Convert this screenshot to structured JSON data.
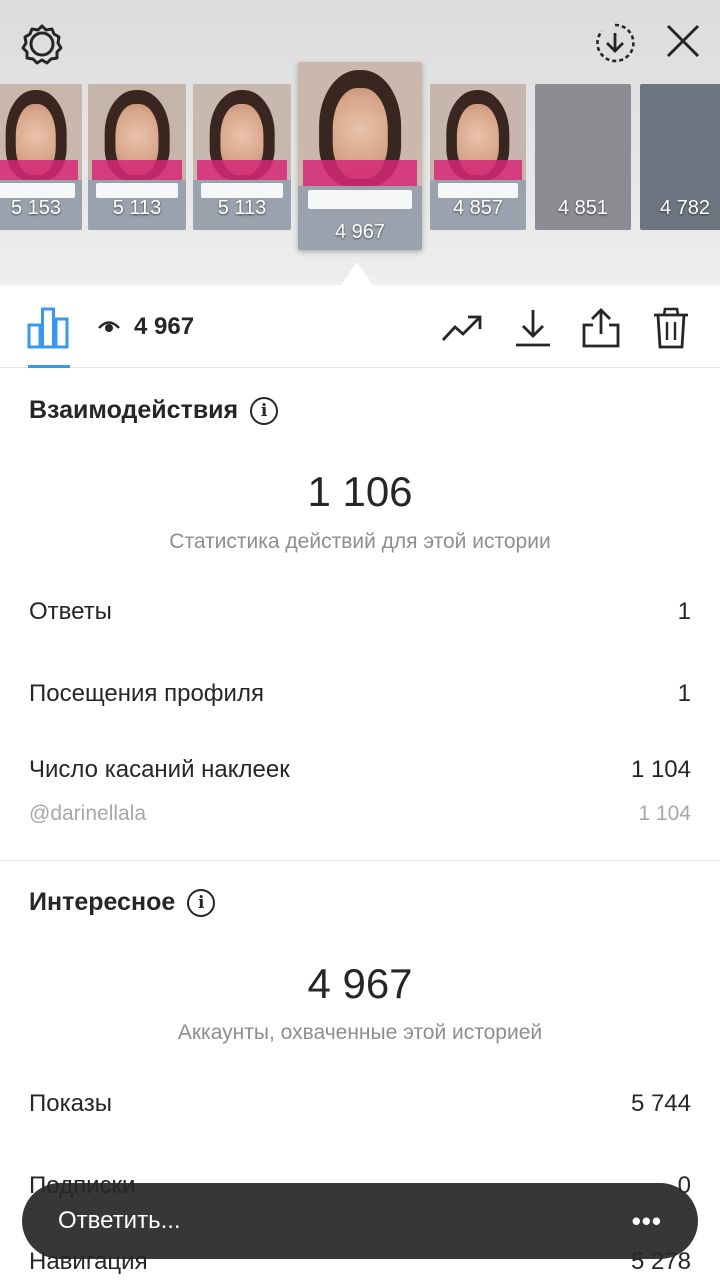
{
  "header": {
    "icons": [
      "settings-icon",
      "download-circle-icon",
      "close-icon"
    ]
  },
  "thumbnails": [
    {
      "views": "5 153",
      "tone": "#c9b7ad"
    },
    {
      "views": "5 113",
      "tone": "#c4b4aa"
    },
    {
      "views": "5 113",
      "tone": "#c8b9b0"
    },
    {
      "views": "4 967",
      "tone": "#cbb8ad",
      "current": true
    },
    {
      "views": "4 857",
      "tone": "#c6b6ad"
    },
    {
      "views": "4 851",
      "tone": "#8c8d93"
    },
    {
      "views": "4 782",
      "tone": "#6d7680"
    }
  ],
  "toolbar": {
    "view_count": "4 967",
    "icons": [
      "bar-chart-icon",
      "eye-icon",
      "trending-icon",
      "download-icon",
      "share-icon",
      "trash-icon"
    ]
  },
  "interactions": {
    "title": "Взаимодействия",
    "total": "1 106",
    "subtitle": "Статистика действий для этой истории",
    "rows": [
      {
        "label": "Ответы",
        "value": "1"
      },
      {
        "label": "Посещения профиля",
        "value": "1"
      },
      {
        "label": "Число касаний наклеек",
        "value": "1 104"
      }
    ],
    "sub_row": {
      "label": "@darinellala",
      "value": "1 104"
    }
  },
  "discovery": {
    "title": "Интересное",
    "total": "4 967",
    "subtitle": "Аккаунты, охваченные этой историей",
    "rows": [
      {
        "label": "Показы",
        "value": "5 744"
      },
      {
        "label": "Подписки",
        "value": "0"
      },
      {
        "label": "Навигация",
        "value": "5 278"
      }
    ]
  },
  "reply_bar": {
    "label": "Ответить...",
    "more": "•••"
  },
  "colors": {
    "accent": "#3897f0",
    "text": "#262626",
    "muted": "#8e8e8e"
  }
}
